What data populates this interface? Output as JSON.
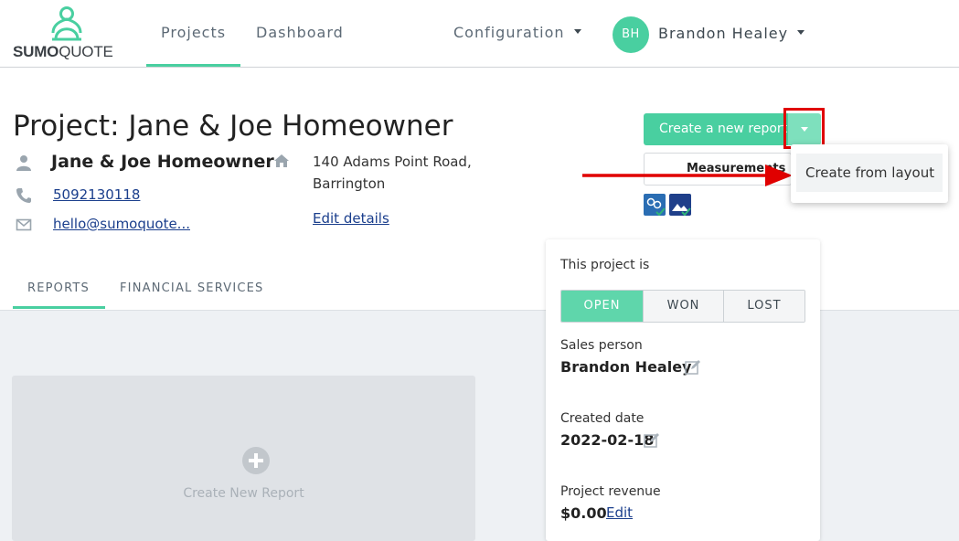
{
  "brand": {
    "logo_part1": "SUMO",
    "logo_part2": "QUOTE",
    "accent_color": "#49cfa0"
  },
  "nav": {
    "projects": "Projects",
    "dashboard": "Dashboard",
    "configuration": "Configuration",
    "user_initials": "BH",
    "user_name": "Brandon Healey"
  },
  "project": {
    "title": "Project: Jane & Joe Homeowner",
    "contact_name": "Jane & Joe Homeowner",
    "phone": "5092130118",
    "email": "hello@sumoquote...",
    "address_line1": "140 Adams Point Road,",
    "address_line2": "Barrington",
    "edit_details": "Edit details"
  },
  "actions": {
    "create_report": "Create a new report",
    "measurements": "Measurements",
    "dropdown_item": "Create from layout"
  },
  "tabs": {
    "reports": "REPORTS",
    "financial": "FINANCIAL SERVICES"
  },
  "new_report": {
    "label": "Create New Report"
  },
  "status_panel": {
    "heading": "This project is",
    "statuses": [
      "OPEN",
      "WON",
      "LOST"
    ],
    "selected_status": "OPEN",
    "sales_person_label": "Sales person",
    "sales_person": "Brandon Healey",
    "created_label": "Created date",
    "created_date": "2022-02-18",
    "revenue_label": "Project revenue",
    "revenue": "$0.00",
    "revenue_edit": "Edit"
  },
  "icons": {
    "logo": "sumoquote-logo-icon",
    "person": "person-icon",
    "phone": "phone-icon",
    "email": "envelope-icon",
    "home": "home-icon",
    "edit": "pencil-icon"
  }
}
